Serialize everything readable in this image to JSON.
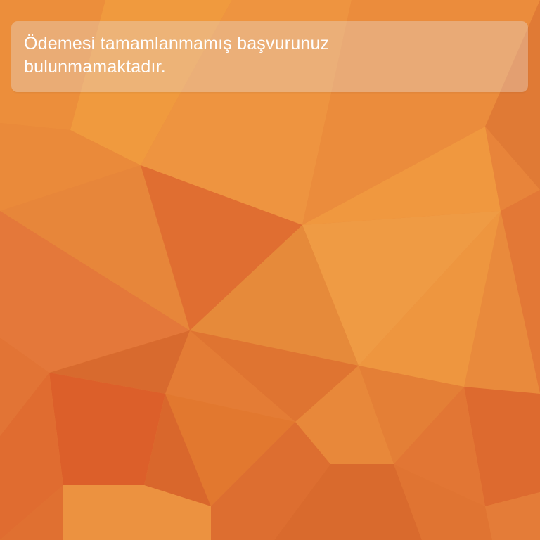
{
  "banner": {
    "message": "Ödemesi tamamlanmamış başvurunuz bulunmamaktadır."
  },
  "background": {
    "pattern": "low-poly-triangles",
    "colors": {
      "base": "#e8843a",
      "light": "#f0a040",
      "dark": "#de6a2e",
      "deep": "#d95a28"
    }
  }
}
